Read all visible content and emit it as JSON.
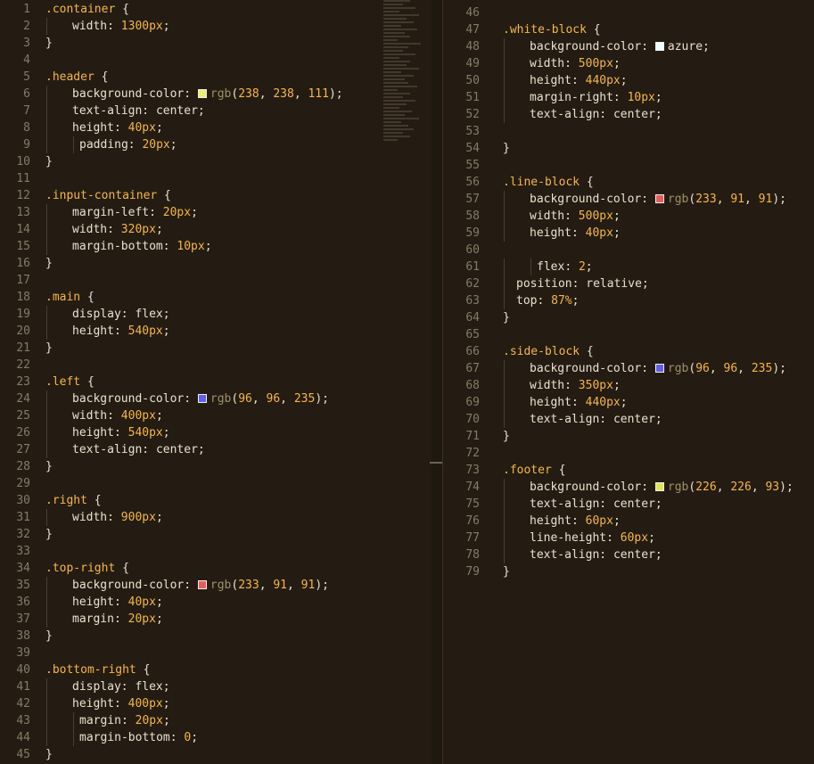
{
  "colors": {
    "yellow": "#eeee6f",
    "red": "#e95b5b",
    "blue": "#6060eb",
    "azure": "#f0ffff",
    "khaki": "#e2e25d"
  },
  "left_lines": [
    {
      "n": "1",
      "t": ".container {"
    },
    {
      "n": "2",
      "t": "width: 1300px;"
    },
    {
      "n": "3",
      "t": "}"
    },
    {
      "n": "4",
      "t": ""
    },
    {
      "n": "5",
      "t": ".header {"
    },
    {
      "n": "6",
      "t": "background-color: rgb(238, 238, 111);"
    },
    {
      "n": "7",
      "t": "text-align: center;"
    },
    {
      "n": "8",
      "t": "height: 40px;"
    },
    {
      "n": "9",
      "t": "padding: 20px;"
    },
    {
      "n": "10",
      "t": "}"
    },
    {
      "n": "11",
      "t": ""
    },
    {
      "n": "12",
      "t": ".input-container {"
    },
    {
      "n": "13",
      "t": "margin-left: 20px;"
    },
    {
      "n": "14",
      "t": "width: 320px;"
    },
    {
      "n": "15",
      "t": "margin-bottom: 10px;"
    },
    {
      "n": "16",
      "t": "}"
    },
    {
      "n": "17",
      "t": ""
    },
    {
      "n": "18",
      "t": ".main {"
    },
    {
      "n": "19",
      "t": "display: flex;"
    },
    {
      "n": "20",
      "t": "height: 540px;"
    },
    {
      "n": "21",
      "t": "}"
    },
    {
      "n": "22",
      "t": ""
    },
    {
      "n": "23",
      "t": ".left {"
    },
    {
      "n": "24",
      "t": "background-color: rgb(96, 96, 235);"
    },
    {
      "n": "25",
      "t": "width: 400px;"
    },
    {
      "n": "26",
      "t": "height: 540px;"
    },
    {
      "n": "27",
      "t": "text-align: center;"
    },
    {
      "n": "28",
      "t": "}"
    },
    {
      "n": "29",
      "t": ""
    },
    {
      "n": "30",
      "t": ".right {"
    },
    {
      "n": "31",
      "t": "width: 900px;"
    },
    {
      "n": "32",
      "t": "}"
    },
    {
      "n": "33",
      "t": ""
    },
    {
      "n": "34",
      "t": ".top-right {"
    },
    {
      "n": "35",
      "t": "background-color: rgb(233, 91, 91);"
    },
    {
      "n": "36",
      "t": "height: 40px;"
    },
    {
      "n": "37",
      "t": "margin: 20px;"
    },
    {
      "n": "38",
      "t": "}"
    },
    {
      "n": "39",
      "t": ""
    },
    {
      "n": "40",
      "t": ".bottom-right {"
    },
    {
      "n": "41",
      "t": "display: flex;"
    },
    {
      "n": "42",
      "t": "height: 400px;"
    },
    {
      "n": "43",
      "t": "margin: 20px;"
    },
    {
      "n": "44",
      "t": "margin-bottom: 0;"
    },
    {
      "n": "45",
      "t": "}"
    }
  ],
  "right_lines": [
    {
      "n": "46",
      "t": ""
    },
    {
      "n": "47",
      "t": ".white-block {"
    },
    {
      "n": "48",
      "t": "background-color: azure;"
    },
    {
      "n": "49",
      "t": "width: 500px;"
    },
    {
      "n": "50",
      "t": "height: 440px;"
    },
    {
      "n": "51",
      "t": "margin-right: 10px;"
    },
    {
      "n": "52",
      "t": "text-align: center;"
    },
    {
      "n": "53",
      "t": ""
    },
    {
      "n": "54",
      "t": "}"
    },
    {
      "n": "55",
      "t": ""
    },
    {
      "n": "56",
      "t": ".line-block {"
    },
    {
      "n": "57",
      "t": "background-color: rgb(233, 91, 91);"
    },
    {
      "n": "58",
      "t": "width: 500px;"
    },
    {
      "n": "59",
      "t": "height: 40px;"
    },
    {
      "n": "60",
      "t": ""
    },
    {
      "n": "61",
      "t": "flex: 2;"
    },
    {
      "n": "62",
      "t": "position: relative;"
    },
    {
      "n": "63",
      "t": "top: 87%;"
    },
    {
      "n": "64",
      "t": "}"
    },
    {
      "n": "65",
      "t": ""
    },
    {
      "n": "66",
      "t": ".side-block {"
    },
    {
      "n": "67",
      "t": "background-color: rgb(96, 96, 235);"
    },
    {
      "n": "68",
      "t": "width: 350px;"
    },
    {
      "n": "69",
      "t": "height: 440px;"
    },
    {
      "n": "70",
      "t": "text-align: center;"
    },
    {
      "n": "71",
      "t": "}"
    },
    {
      "n": "72",
      "t": ""
    },
    {
      "n": "73",
      "t": ".footer {"
    },
    {
      "n": "74",
      "t": "background-color: rgb(226, 226, 93);"
    },
    {
      "n": "75",
      "t": "text-align: center;"
    },
    {
      "n": "76",
      "t": "height: 60px;"
    },
    {
      "n": "77",
      "t": "line-height: 60px;"
    },
    {
      "n": "78",
      "t": "text-align: center;"
    },
    {
      "n": "79",
      "t": "}"
    }
  ]
}
